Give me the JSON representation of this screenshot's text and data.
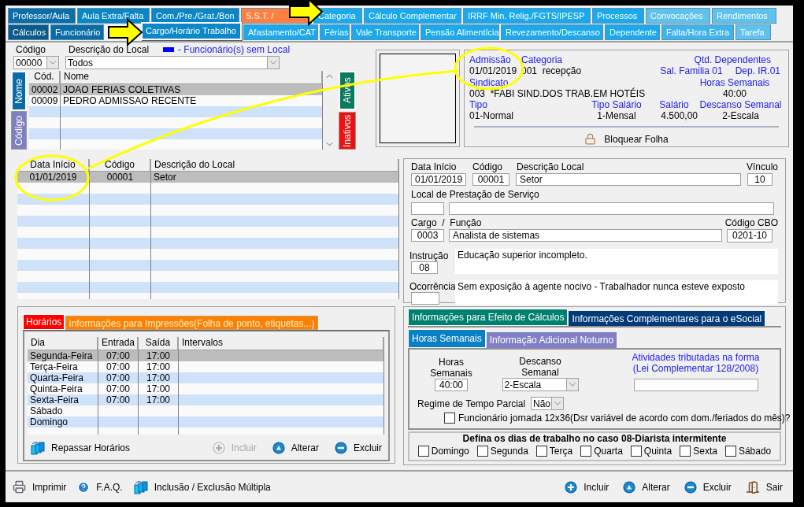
{
  "tabs_row1": [
    {
      "label": "Professor/Aula",
      "selected": false,
      "color": "#0b6ea8"
    },
    {
      "label": "Aula Extra/Falta",
      "selected": false,
      "color": "#0a85c6"
    },
    {
      "label": "Com./Pre./Grat./Bon",
      "selected": false,
      "color": "#0a85c6"
    },
    {
      "label": "S.S.T. /",
      "selected": false,
      "color": "#ff7f40"
    },
    {
      "label": "Categoria",
      "selected": false,
      "color": "#19a9ec"
    },
    {
      "label": "Cálculo Complementar",
      "selected": false,
      "color": "#19a9ec"
    },
    {
      "label": "IRRF Min. Relig./FGTS/IPESP",
      "selected": false,
      "color": "#19a9ec"
    },
    {
      "label": "Processos",
      "selected": false,
      "color": "#19a9ec"
    },
    {
      "label": "Convocações",
      "selected": false,
      "color": "#5ec2ee"
    },
    {
      "label": "Rendimentos",
      "selected": false,
      "color": "#5ec2ee"
    }
  ],
  "tabs_row2": [
    {
      "label": "Cálculos",
      "selected": false,
      "color": "#0b5a8a"
    },
    {
      "label": "Funcionário",
      "selected": false,
      "color": "#0a6ca6"
    },
    {
      "label": "Cargo/Horário Trabalho",
      "selected": true,
      "color": "#0a88c9"
    },
    {
      "label": "Afastamento/CAT",
      "selected": false,
      "color": "#19a9ec"
    },
    {
      "label": "Férias",
      "selected": false,
      "color": "#19a9ec"
    },
    {
      "label": "Vale Transporte",
      "selected": false,
      "color": "#19a9ec"
    },
    {
      "label": "Pensão Alimentícia",
      "selected": false,
      "color": "#19a9ec"
    },
    {
      "label": "Revezamento/Descanso",
      "selected": false,
      "color": "#19a9ec"
    },
    {
      "label": "Dependente",
      "selected": false,
      "color": "#19a9ec"
    },
    {
      "label": "Falta/Hora Extra",
      "selected": false,
      "color": "#3fb4ec"
    },
    {
      "label": "Tarefa",
      "selected": false,
      "color": "#5ec2ee"
    }
  ],
  "filter": {
    "codigo_label": "Código",
    "codigo_value": "00000",
    "descricao_label": "Descrição do Local",
    "descricao_value": "Todos",
    "legend": "- Funcionário(s) sem Local"
  },
  "employees": {
    "side_tabs": [
      {
        "label": "Nome",
        "selected": true,
        "color": "#0a6ca6"
      },
      {
        "label": "Código",
        "selected": false,
        "color": "#8080c0"
      }
    ],
    "columns": [
      "Cód.",
      "Nome"
    ],
    "rows": [
      {
        "cells": [
          "00002",
          "JOAO FERIAS COLETIVAS"
        ],
        "selected": true
      },
      {
        "cells": [
          "00009",
          "PEDRO ADMISSAO RECENTE"
        ],
        "selected": false
      }
    ],
    "status_tabs": [
      {
        "label": "Ativos",
        "selected": true,
        "color": "#0a7a60"
      },
      {
        "label": "Inativos",
        "selected": false,
        "color": "#ee1111"
      }
    ]
  },
  "info": {
    "admissao_label": "Admissão",
    "admissao_value": "01/01/2019",
    "categoria_label": "Categoria",
    "categoria_value": "001  recepção",
    "dependentes_label": "Qtd. Dependentes",
    "sal_familia": "Sal. Familia 01",
    "dep_ir": "Dep. IR.01",
    "sindicato_label": "Sindicato",
    "sindicato_value": "003  *FABI SIND.DOS TRAB.EM HOTÉIS",
    "horas_label": "Horas Semanais",
    "horas_value": "40:00",
    "tipo_label": "Tipo",
    "tipo_value": "01-Normal",
    "tipo_salario_label": "Tipo Salário",
    "tipo_salario_value": "1-Mensal",
    "salario_label": "Salário",
    "salario_value": "4.500,00",
    "descanso_label": "Descanso Semanal",
    "descanso_value": "2-Escala",
    "lock_button": "Bloquear Folha"
  },
  "locations": {
    "columns": [
      "Data Início",
      "Código",
      "Descrição do Local"
    ],
    "rows": [
      {
        "cells": [
          "01/01/2019",
          "00001",
          "Setor"
        ],
        "selected": true
      }
    ]
  },
  "location_form": {
    "data_label": "Data Início",
    "data_value": "01/01/2019",
    "codigo_label": "Código",
    "codigo_value": "00001",
    "descricao_label": "Descrição Local",
    "descricao_value": "Setor",
    "vinculo_label": "Vínculo",
    "vinculo_value": "10",
    "prestacao_label": "Local de Prestação de Serviço",
    "cargo_label": "Cargo  /  Função",
    "cargo_code": "0003",
    "cargo_value": "Analista de sistemas",
    "cbo_label": "Código CBO",
    "cbo_value": "0201-10",
    "instrucao_label": "Instrução",
    "instrucao_code": "08",
    "instrucao_text": "Educação superior incompleto.",
    "ocorrencia_label": "Ocorrência",
    "ocorrencia_text": "Sem exposição à agente nocivo - Trabalhador nunca esteve exposto"
  },
  "schedule": {
    "tabs": [
      {
        "label": "Horários",
        "selected": true,
        "color": "#ff0000"
      },
      {
        "label": "Informações para Impressões(Folha de ponto, etiquetas...)",
        "selected": false,
        "color": "#ff8000"
      }
    ],
    "columns": [
      "Dia",
      "Entrada",
      "Saída",
      "Intervalos"
    ],
    "rows": [
      {
        "cells": [
          "Segunda-Feira",
          "07:00",
          "17:00"
        ],
        "selected": true
      },
      {
        "cells": [
          "Terça-Feira",
          "07:00",
          "17:00"
        ],
        "selected": false
      },
      {
        "cells": [
          "Quarta-Feira",
          "07:00",
          "17:00"
        ],
        "selected": false
      },
      {
        "cells": [
          "Quinta-Feira",
          "07:00",
          "17:00"
        ],
        "selected": false
      },
      {
        "cells": [
          "Sexta-Feira",
          "07:00",
          "17:00"
        ],
        "selected": false
      },
      {
        "cells": [
          "Sábado"
        ],
        "selected": false
      },
      {
        "cells": [
          "Domingo"
        ],
        "selected": false
      }
    ],
    "actions": [
      {
        "label": "Repassar Horários",
        "kind": "transfer",
        "disabled": false
      },
      {
        "label": "Incluir",
        "kind": "add",
        "disabled": true
      },
      {
        "label": "Alterar",
        "kind": "edit",
        "disabled": false
      },
      {
        "label": "Excluir",
        "kind": "delete",
        "disabled": false
      }
    ]
  },
  "calc": {
    "tabs": [
      {
        "label": "Informações para Efeito de Cálculos",
        "selected": true,
        "color": "#00806e"
      },
      {
        "label": "Informações Complementares para o eSocial",
        "selected": false,
        "color": "#003a78"
      }
    ],
    "subtabs": [
      {
        "label": "Horas Semanais",
        "selected": true,
        "color": "#0a80c4"
      },
      {
        "label": "Informação Adicional Noturno",
        "selected": false,
        "color": "#8080c4"
      }
    ],
    "horas_label": "Horas Semanais",
    "horas_value": "40:00",
    "descanso_label": "Descanso Semanal",
    "descanso_value": "2-Escala",
    "atividades_label": "Atividades tributadas na forma (Lei Complementar 128/2008)",
    "regime_label": "Regime de Tempo Parcial",
    "regime_value": "Não",
    "jornada": {
      "label": "Funcionário jornada 12x36(Dsr variável de acordo com dom./feriados do mês)?",
      "checked": false
    },
    "days_title": "Defina os dias de trabalho no caso 08-Diarista intermitente",
    "days": [
      {
        "label": "Domingo",
        "checked": false
      },
      {
        "label": "Segunda",
        "checked": false
      },
      {
        "label": "Terça",
        "checked": false
      },
      {
        "label": "Quarta",
        "checked": false
      },
      {
        "label": "Quinta",
        "checked": false
      },
      {
        "label": "Sexta",
        "checked": false
      },
      {
        "label": "Sábado",
        "checked": false
      }
    ]
  },
  "footer": {
    "left": [
      {
        "label": "Imprimir",
        "kind": "print"
      },
      {
        "label": "F.A.Q.",
        "kind": "help"
      },
      {
        "label": "Inclusão / Exclusão Múltipla",
        "kind": "transfer"
      }
    ],
    "right": [
      {
        "label": "Incluir",
        "kind": "add"
      },
      {
        "label": "Alterar",
        "kind": "edit"
      },
      {
        "label": "Excluir",
        "kind": "delete"
      },
      {
        "label": "Sair",
        "kind": "exit"
      }
    ]
  }
}
